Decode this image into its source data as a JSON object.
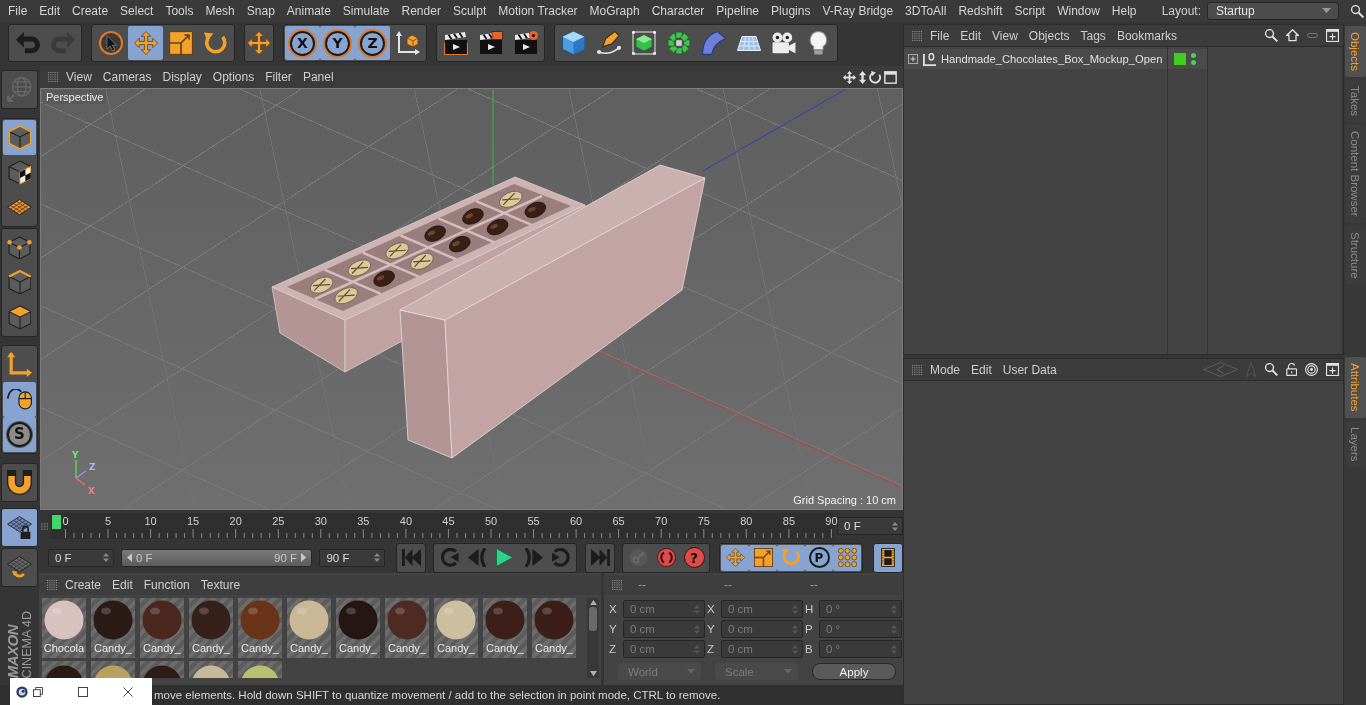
{
  "menu_bar": {
    "items": [
      "File",
      "Edit",
      "Create",
      "Select",
      "Tools",
      "Mesh",
      "Snap",
      "Animate",
      "Simulate",
      "Render",
      "Sculpt",
      "Motion Tracker",
      "MoGraph",
      "Character",
      "Pipeline",
      "Plugins",
      "V-Ray Bridge",
      "3DToAll",
      "Redshift",
      "Script",
      "Window",
      "Help"
    ],
    "layout_label": "Layout:",
    "layout_value": "Startup"
  },
  "toolbar": {
    "groups": [
      {
        "buttons": [
          {
            "selected": false,
            "disabled": false
          },
          {
            "selected": false,
            "disabled": true
          }
        ]
      },
      {
        "buttons": [
          {
            "selected": false
          },
          {
            "selected": true
          },
          {
            "selected": false
          },
          {
            "selected": false
          }
        ]
      },
      {
        "buttons": [
          {
            "selected": false
          }
        ]
      },
      {
        "buttons": [
          {
            "label": "X",
            "selected": true
          },
          {
            "label": "Y",
            "selected": true
          },
          {
            "label": "Z",
            "selected": true
          },
          {
            "selected": false
          }
        ]
      },
      {
        "buttons": [
          {
            "selected": false
          },
          {
            "selected": false
          },
          {
            "selected": false
          }
        ]
      },
      {
        "buttons": [
          {
            "selected": false
          },
          {
            "selected": false
          },
          {
            "selected": false
          },
          {
            "selected": false
          },
          {
            "selected": false
          },
          {
            "selected": false
          },
          {
            "selected": false
          },
          {
            "selected": false
          }
        ]
      }
    ]
  },
  "left_toolbar": {
    "groups": [
      {
        "buttons": [
          {
            "selected": false,
            "disabled": true
          }
        ]
      },
      {
        "buttons": [
          {
            "selected": true
          },
          {
            "selected": false
          },
          {
            "selected": false
          }
        ]
      },
      {
        "buttons": [
          {
            "selected": false
          },
          {
            "selected": false
          },
          {
            "selected": false
          }
        ]
      },
      {
        "buttons": [
          {
            "selected": false
          },
          {
            "selected": true
          },
          {
            "label": "S",
            "selected": true
          }
        ]
      },
      {
        "buttons": [
          {
            "selected": false
          }
        ]
      },
      {
        "buttons": [
          {
            "selected": true
          }
        ]
      },
      {
        "buttons": [
          {
            "selected": false
          }
        ]
      }
    ]
  },
  "viewport": {
    "menu": [
      "View",
      "Cameras",
      "Display",
      "Options",
      "Filter",
      "Panel"
    ],
    "camera": "Perspective",
    "grid_spacing": "Grid Spacing : 10 cm",
    "axis_labels": [
      "Y",
      "Z",
      "X"
    ]
  },
  "timeline": {
    "ticks": [
      "0",
      "5",
      "10",
      "15",
      "20",
      "25",
      "30",
      "35",
      "40",
      "45",
      "50",
      "55",
      "60",
      "65",
      "70",
      "75",
      "80",
      "85",
      "90"
    ],
    "level": 0,
    "current_frame": "0 F"
  },
  "transport": {
    "start_frame": "0 F",
    "range_slider": {
      "start": "0 F",
      "end": "90 F",
      "level": 1
    },
    "end_frame": "90 F",
    "groups": [
      {
        "buttons": [
          {
            "selected": false
          }
        ]
      },
      {
        "buttons": [
          {
            "selected": false
          },
          {
            "selected": false
          },
          {
            "selected": false
          },
          {
            "selected": false
          },
          {
            "selected": false
          }
        ]
      },
      {
        "buttons": [
          {
            "selected": false
          }
        ]
      },
      {
        "buttons": [
          {
            "selected": false,
            "disabled": true
          },
          {
            "selected": false,
            "disabled": false
          },
          {
            "label": "?",
            "selected": false,
            "disabled": false
          }
        ]
      },
      {
        "buttons": [
          {
            "selected": true
          },
          {
            "selected": true
          },
          {
            "selected": true
          },
          {
            "label": "P",
            "selected": true
          },
          {
            "selected": true
          }
        ]
      },
      {
        "buttons": [
          {
            "selected": true
          }
        ]
      }
    ]
  },
  "materials": {
    "menu": [
      "Create",
      "Edit",
      "Function",
      "Texture"
    ],
    "items": [
      {
        "name": "Chocola",
        "color": "#d8c2c0"
      },
      {
        "name": "Candy_",
        "color": "#2b1b16"
      },
      {
        "name": "Candy_",
        "color": "#4a2820"
      },
      {
        "name": "Candy_",
        "color": "#35201a"
      },
      {
        "name": "Candy_",
        "color": "#6a3418"
      },
      {
        "name": "Candy_",
        "color": "#c8b898"
      },
      {
        "name": "Candy_",
        "color": "#241612"
      },
      {
        "name": "Candy_",
        "color": "#4d2a22"
      },
      {
        "name": "Candy_",
        "color": "#cbbf9f"
      },
      {
        "name": "Candy_",
        "color": "#3d1f1a"
      },
      {
        "name": "Candy_",
        "color": "#3b1e18"
      }
    ],
    "more_items": [
      {
        "color": "#2a1a14"
      },
      {
        "color": "#b8a060"
      },
      {
        "color": "#2e1c18"
      },
      {
        "color": "#c8b89a"
      },
      {
        "color": "#b8c070"
      }
    ]
  },
  "coordinates": {
    "headers": [
      "--",
      "--",
      "--"
    ],
    "rows": [
      {
        "labels": [
          "X",
          "X",
          "H"
        ],
        "values": [
          "0 cm",
          "0 cm",
          "0 °"
        ]
      },
      {
        "labels": [
          "Y",
          "Y",
          "P"
        ],
        "values": [
          "0 cm",
          "0 cm",
          "0 °"
        ]
      },
      {
        "labels": [
          "Z",
          "Z",
          "B"
        ],
        "values": [
          "0 cm",
          "0 cm",
          "0 °"
        ]
      }
    ],
    "disabled": true,
    "dropdowns": [
      "World",
      "Scale"
    ],
    "apply": "Apply"
  },
  "status_bar": {
    "text": "move elements. Hold down SHIFT to quantize movement / add to the selection in point mode, CTRL to remove."
  },
  "object_manager": {
    "menu": [
      "File",
      "Edit",
      "View",
      "Objects",
      "Tags",
      "Bookmarks"
    ],
    "objects": [
      {
        "name": "Handmade_Chocolates_Box_Mockup_Open",
        "expanded": false,
        "color": "#3ccf1e",
        "editor_visible": true,
        "render_visible": true
      }
    ]
  },
  "attribute_manager": {
    "menu": [
      "Mode",
      "Edit",
      "User Data"
    ]
  },
  "side_tabs": {
    "top": [
      {
        "label": "Objects",
        "selected": true
      },
      {
        "label": "Takes",
        "selected": false
      },
      {
        "label": "Content Browser",
        "selected": false
      },
      {
        "label": "Structure",
        "selected": false
      }
    ],
    "bottom": [
      {
        "label": "Attributes",
        "selected": true
      },
      {
        "label": "Layers",
        "selected": false
      }
    ]
  },
  "logo": {
    "brand": "MAXON",
    "product": "CINEMA 4D"
  }
}
